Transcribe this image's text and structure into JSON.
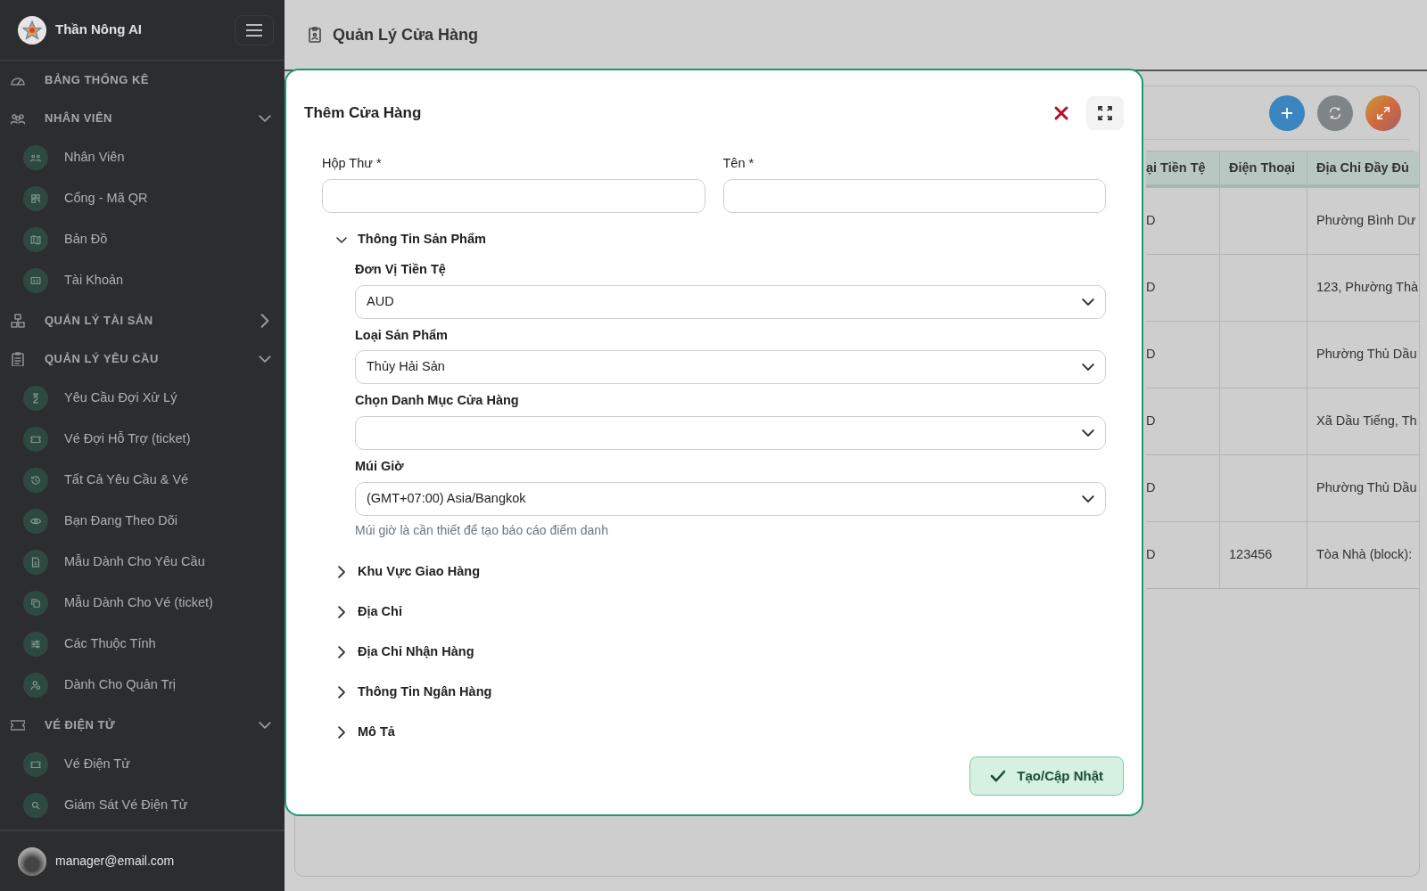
{
  "sidebar": {
    "brand": "Thần Nông AI",
    "menu": [
      {
        "kind": "link",
        "label": "BẢNG THỐNG KÊ"
      },
      {
        "kind": "group",
        "label": "NHÂN VIÊN",
        "expanded": true,
        "children": [
          {
            "label": "Nhân Viên"
          },
          {
            "label": "Cổng - Mã QR"
          },
          {
            "label": "Bản Đồ"
          },
          {
            "label": "Tài Khoản"
          }
        ]
      },
      {
        "kind": "group",
        "label": "QUẢN LÝ TÀI SẢN",
        "expanded": false
      },
      {
        "kind": "group",
        "label": "QUẢN LÝ YÊU CẦU",
        "expanded": true,
        "children": [
          {
            "label": "Yêu Cầu Đợi Xử Lý"
          },
          {
            "label": "Vé Đợi Hỗ Trợ (ticket)"
          },
          {
            "label": "Tất Cả Yêu Cầu & Vé"
          },
          {
            "label": "Bạn Đang Theo Dõi"
          },
          {
            "label": "Mẫu Dành Cho Yêu Cầu"
          },
          {
            "label": "Mẫu Dành Cho Vé (ticket)"
          },
          {
            "label": "Các Thuộc Tính"
          },
          {
            "label": "Dành Cho Quản Trị"
          }
        ]
      },
      {
        "kind": "group",
        "label": "VÉ ĐIỆN TỬ",
        "expanded": true,
        "children": [
          {
            "label": "Vé Điện Tử"
          },
          {
            "label": "Giám Sát Vé Điện Tử"
          }
        ]
      }
    ],
    "user": "manager@email.com"
  },
  "page": {
    "title": "Quản Lý Cửa Hàng"
  },
  "table": {
    "columns": [
      "ại Tiền Tệ",
      "Điện Thoại",
      "Địa Chỉ Đầy Đủ"
    ],
    "rows": [
      [
        "D",
        "",
        "Phường Bình Dư"
      ],
      [
        "D",
        "",
        "123, Phường Thà"
      ],
      [
        "D",
        "",
        "Phường Thủ Dầu"
      ],
      [
        "D",
        "",
        "Xã Dầu Tiếng, Th"
      ],
      [
        "D",
        "",
        "Phường Thủ Dầu"
      ],
      [
        "D",
        "123456",
        "Tòa Nhà (block):"
      ]
    ]
  },
  "modal": {
    "title": "Thêm Cửa Hàng",
    "fields": [
      {
        "label": "Hộp Thư *"
      },
      {
        "label": "Tên *"
      }
    ],
    "sections": [
      {
        "title": "Thông Tin Sản Phẩm",
        "expanded": true,
        "fields": [
          {
            "label": "Đơn Vị Tiền Tệ",
            "value": "AUD"
          },
          {
            "label": "Loại Sản Phẩm",
            "value": "Thủy Hải Sản"
          },
          {
            "label": "Chọn Danh Mục Cửa Hàng"
          },
          {
            "label": "Múi Giờ",
            "value": "(GMT+07:00) Asia/Bangkok",
            "help": "Múi giờ là cần thiết để tạo báo cáo điểm danh"
          }
        ]
      },
      {
        "title": "Khu Vực Giao Hàng",
        "expanded": false
      },
      {
        "title": "Địa Chỉ",
        "expanded": false
      },
      {
        "title": "Địa Chỉ Nhận Hàng",
        "expanded": false
      },
      {
        "title": "Thông Tin Ngân Hàng",
        "expanded": false
      },
      {
        "title": "Mô Tả",
        "expanded": false
      }
    ],
    "submit": "Tạo/Cập Nhật"
  }
}
